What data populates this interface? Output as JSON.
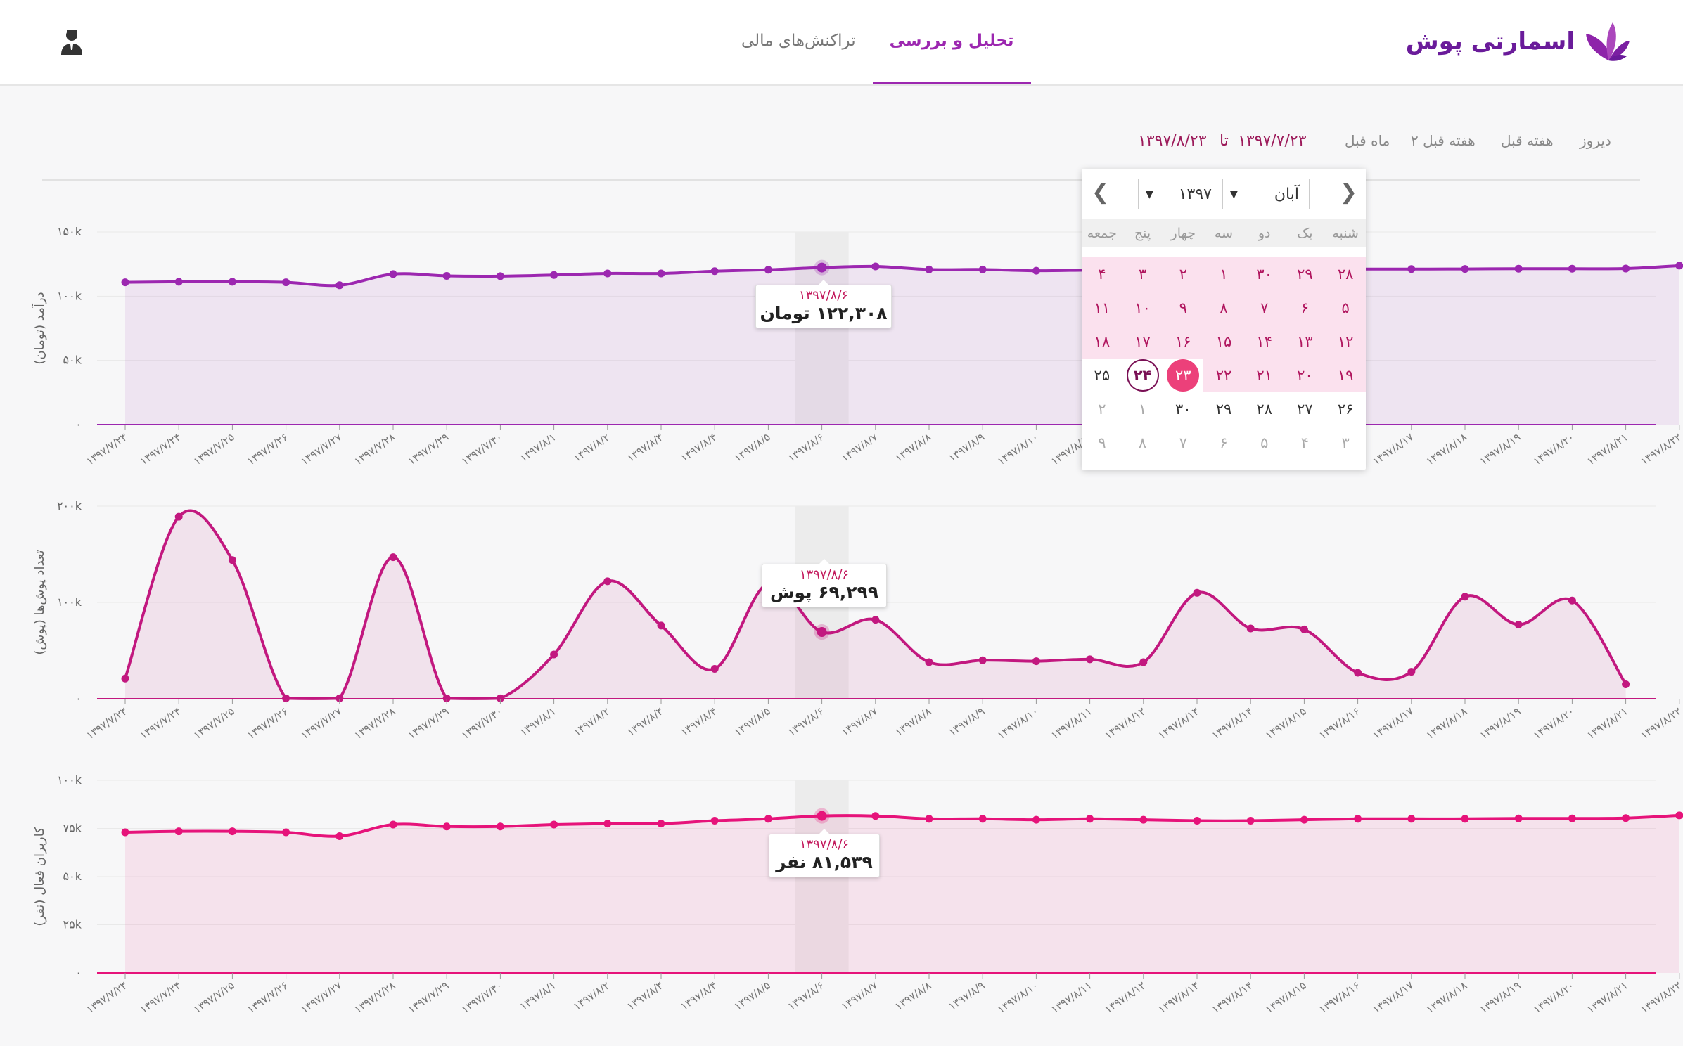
{
  "brand": {
    "name": "اسمارتی پوش",
    "color": "#6a1b9a"
  },
  "nav": {
    "tabs": [
      {
        "label": "تحلیل و بررسی",
        "active": true
      },
      {
        "label": "تراکنش‌های مالی",
        "active": false
      }
    ]
  },
  "user_icon": "user-icon",
  "filter": {
    "quick": [
      "دیروز",
      "هفته قبل",
      "۲ هفته قبل",
      "ماه قبل"
    ],
    "range_from": "۱۳۹۷/۷/۲۳",
    "range_sep": "تا",
    "range_to": "۱۳۹۷/۸/۲۳"
  },
  "calendar": {
    "month": "آبان",
    "year": "۱۳۹۷",
    "weekdays": [
      "شنبه",
      "یک",
      "دو",
      "سه",
      "چهار",
      "پنج",
      "جمعه"
    ],
    "rows": [
      [
        "۲۸",
        "۲۹",
        "۳۰",
        "۱",
        "۲",
        "۳",
        "۴"
      ],
      [
        "۵",
        "۶",
        "۷",
        "۸",
        "۹",
        "۱۰",
        "۱۱"
      ],
      [
        "۱۲",
        "۱۳",
        "۱۴",
        "۱۵",
        "۱۶",
        "۱۷",
        "۱۸"
      ],
      [
        "۱۹",
        "۲۰",
        "۲۱",
        "۲۲",
        "۲۳",
        "۲۴",
        "۲۵"
      ],
      [
        "۲۶",
        "۲۷",
        "۲۸",
        "۲۹",
        "۳۰",
        "۱",
        "۲"
      ],
      [
        "۳",
        "۴",
        "۵",
        "۶",
        "۷",
        "۸",
        "۹"
      ]
    ],
    "range_start": "۲۳",
    "today": "۲۴"
  },
  "colors": {
    "purple": "#9c27b0",
    "magenta": "#c2187f",
    "pink": "#e6137a"
  },
  "chart_data": [
    {
      "type": "area",
      "ylabel": "درآمد (تومان)",
      "yticks": [
        "۰",
        "۵۰k",
        "۱۰۰k",
        "۱۵۰k"
      ],
      "ylim": [
        0,
        150000
      ],
      "x": [
        "۱۳۹۷/۷/۲۳",
        "۱۳۹۷/۷/۲۴",
        "۱۳۹۷/۷/۲۵",
        "۱۳۹۷/۷/۲۶",
        "۱۳۹۷/۷/۲۷",
        "۱۳۹۷/۷/۲۸",
        "۱۳۹۷/۷/۲۹",
        "۱۳۹۷/۷/۳۰",
        "۱۳۹۷/۸/۱",
        "۱۳۹۷/۸/۲",
        "۱۳۹۷/۸/۳",
        "۱۳۹۷/۸/۴",
        "۱۳۹۷/۸/۵",
        "۱۳۹۷/۸/۶",
        "۱۳۹۷/۸/۷",
        "۱۳۹۷/۸/۸",
        "۱۳۹۷/۸/۹",
        "۱۳۹۷/۸/۱۰",
        "۱۳۹۷/۸/۱۱",
        "۱۳۹۷/۸/۱۲",
        "۱۳۹۷/۸/۱۳",
        "۱۳۹۷/۸/۱۴",
        "۱۳۹۷/۸/۱۵",
        "۱۳۹۷/۸/۱۶",
        "۱۳۹۷/۸/۱۷",
        "۱۳۹۷/۸/۱۸",
        "۱۳۹۷/۸/۱۹",
        "۱۳۹۷/۸/۲۰",
        "۱۳۹۷/۸/۲۱",
        "۱۳۹۷/۸/۲۲"
      ],
      "values": [
        110800,
        111200,
        111200,
        110800,
        108500,
        117200,
        115800,
        115600,
        116500,
        117700,
        117700,
        119500,
        120600,
        122308,
        123200,
        120800,
        120800,
        119800,
        120300,
        120600,
        120000,
        119800,
        120400,
        121100,
        121100,
        121200,
        121400,
        121400,
        121500,
        123800
      ],
      "color": "#9c27b0",
      "tooltip": {
        "date": "۱۳۹۷/۸/۶",
        "value": "۱۲۲,۳۰۸ تومان"
      }
    },
    {
      "type": "area",
      "ylabel": "تعداد پوش‌ها (پوش)",
      "yticks": [
        "۰",
        "۱۰۰k",
        "۲۰۰k"
      ],
      "ylim": [
        0,
        200000
      ],
      "x": [
        "۱۳۹۷/۷/۲۳",
        "۱۳۹۷/۷/۲۴",
        "۱۳۹۷/۷/۲۵",
        "۱۳۹۷/۷/۲۶",
        "۱۳۹۷/۷/۲۷",
        "۱۳۹۷/۷/۲۸",
        "۱۳۹۷/۷/۲۹",
        "۱۳۹۷/۷/۳۰",
        "۱۳۹۷/۸/۱",
        "۱۳۹۷/۸/۲",
        "۱۳۹۷/۸/۳",
        "۱۳۹۷/۸/۴",
        "۱۳۹۷/۸/۵",
        "۱۳۹۷/۸/۶",
        "۱۳۹۷/۸/۷",
        "۱۳۹۷/۸/۸",
        "۱۳۹۷/۸/۹",
        "۱۳۹۷/۸/۱۰",
        "۱۳۹۷/۸/۱۱",
        "۱۳۹۷/۸/۱۲",
        "۱۳۹۷/۸/۱۳",
        "۱۳۹۷/۸/۱۴",
        "۱۳۹۷/۸/۱۵",
        "۱۳۹۷/۸/۱۶",
        "۱۳۹۷/۸/۱۷",
        "۱۳۹۷/۸/۱۸",
        "۱۳۹۷/۸/۱۹",
        "۱۳۹۷/۸/۲۰",
        "۱۳۹۷/۸/۲۱",
        "۱۳۹۷/۸/۲۲"
      ],
      "values": [
        21000,
        189000,
        144000,
        500,
        500,
        147000,
        500,
        500,
        46000,
        122000,
        76000,
        31000,
        120000,
        69299,
        82000,
        38000,
        40000,
        39000,
        41000,
        38000,
        110000,
        73000,
        72000,
        27000,
        28000,
        106000,
        77000,
        102000,
        15000
      ],
      "color": "#c2187f",
      "tooltip": {
        "date": "۱۳۹۷/۸/۶",
        "value": "۶۹,۲۹۹ پوش"
      }
    },
    {
      "type": "area",
      "ylabel": "کاربران فعال (نفر)",
      "yticks": [
        "۰",
        "۲۵k",
        "۵۰k",
        "۷۵k",
        "۱۰۰k"
      ],
      "ylim": [
        0,
        100000
      ],
      "x": [
        "۱۳۹۷/۷/۲۳",
        "۱۳۹۷/۷/۲۴",
        "۱۳۹۷/۷/۲۵",
        "۱۳۹۷/۷/۲۶",
        "۱۳۹۷/۷/۲۷",
        "۱۳۹۷/۷/۲۸",
        "۱۳۹۷/۷/۲۹",
        "۱۳۹۷/۷/۳۰",
        "۱۳۹۷/۸/۱",
        "۱۳۹۷/۸/۲",
        "۱۳۹۷/۸/۳",
        "۱۳۹۷/۸/۴",
        "۱۳۹۷/۸/۵",
        "۱۳۹۷/۸/۶",
        "۱۳۹۷/۸/۷",
        "۱۳۹۷/۸/۸",
        "۱۳۹۷/۸/۹",
        "۱۳۹۷/۸/۱۰",
        "۱۳۹۷/۸/۱۱",
        "۱۳۹۷/۸/۱۲",
        "۱۳۹۷/۸/۱۳",
        "۱۳۹۷/۸/۱۴",
        "۱۳۹۷/۸/۱۵",
        "۱۳۹۷/۸/۱۶",
        "۱۳۹۷/۸/۱۷",
        "۱۳۹۷/۸/۱۸",
        "۱۳۹۷/۸/۱۹",
        "۱۳۹۷/۸/۲۰",
        "۱۳۹۷/۸/۲۱",
        "۱۳۹۷/۸/۲۲"
      ],
      "values": [
        73000,
        73500,
        73500,
        73000,
        71000,
        77000,
        76000,
        76000,
        77000,
        77500,
        77500,
        79000,
        80000,
        81539,
        81500,
        80000,
        80000,
        79500,
        80000,
        79500,
        79000,
        79000,
        79500,
        80000,
        80000,
        80000,
        80200,
        80200,
        80400,
        81800
      ],
      "color": "#e6137a",
      "tooltip": {
        "date": "۱۳۹۷/۸/۶",
        "value": "۸۱,۵۳۹ نفر"
      }
    }
  ]
}
